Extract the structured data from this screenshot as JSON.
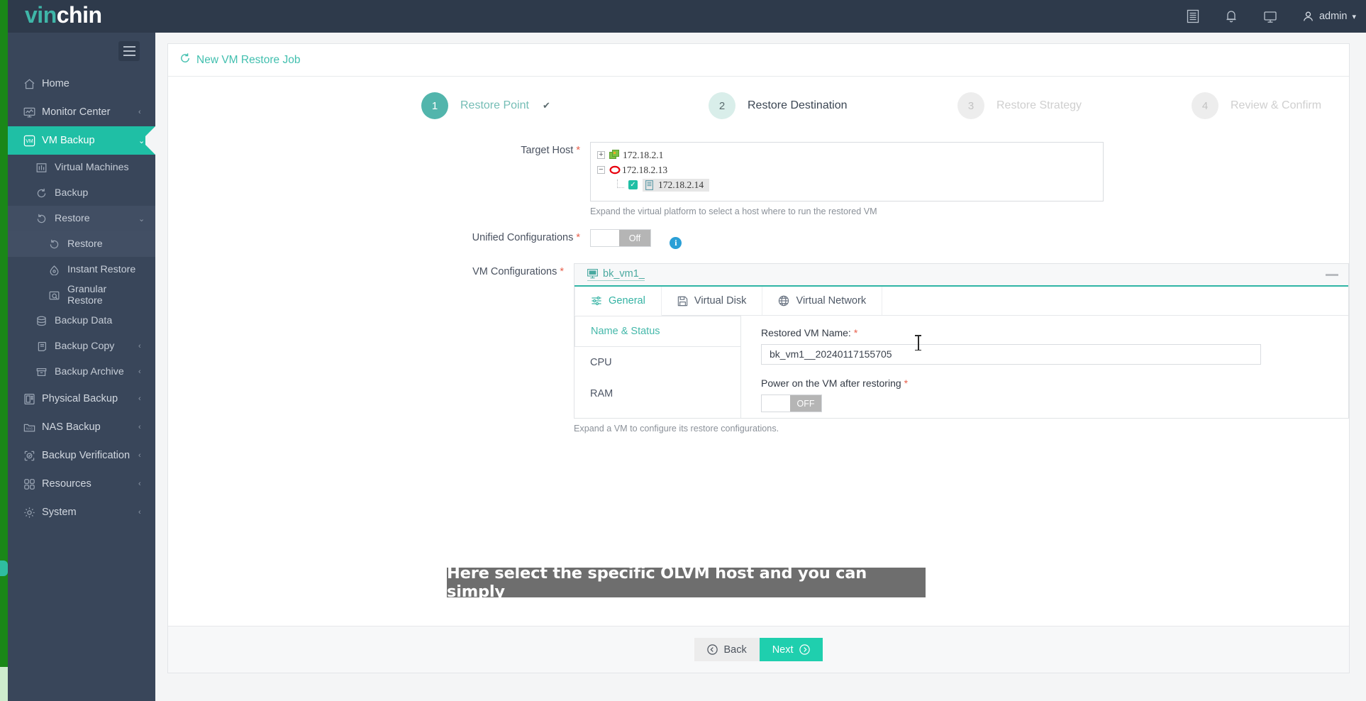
{
  "brand": {
    "part1": "vin",
    "part2": "chin"
  },
  "header": {
    "icons": [
      "list-icon",
      "bell-icon",
      "monitor-icon"
    ],
    "user": "admin"
  },
  "sidebar": {
    "items": [
      {
        "label": "Home",
        "icon": "home-icon",
        "level": 0,
        "caret": "",
        "state": "normal"
      },
      {
        "label": "Monitor Center",
        "icon": "monitor-chart-icon",
        "level": 0,
        "caret": "‹",
        "state": "normal"
      },
      {
        "label": "VM Backup",
        "icon": "vm-icon",
        "level": 0,
        "caret": "⌄",
        "state": "active"
      },
      {
        "label": "Virtual Machines",
        "icon": "grid-icon",
        "level": 1,
        "caret": "",
        "state": "normal"
      },
      {
        "label": "Backup",
        "icon": "refresh-icon",
        "level": 1,
        "caret": "",
        "state": "normal"
      },
      {
        "label": "Restore",
        "icon": "restore-icon",
        "level": 1,
        "caret": "⌄",
        "state": "open"
      },
      {
        "label": "Restore",
        "icon": "restore-icon",
        "level": 2,
        "caret": "",
        "state": "current"
      },
      {
        "label": "Instant Restore",
        "icon": "instant-icon",
        "level": 2,
        "caret": "",
        "state": "normal"
      },
      {
        "label": "Granular Restore",
        "icon": "granular-icon",
        "level": 2,
        "caret": "",
        "state": "normal"
      },
      {
        "label": "Backup Data",
        "icon": "database-icon",
        "level": 1,
        "caret": "",
        "state": "normal"
      },
      {
        "label": "Backup Copy",
        "icon": "copy-icon",
        "level": 1,
        "caret": "‹",
        "state": "normal"
      },
      {
        "label": "Backup Archive",
        "icon": "archive-icon",
        "level": 1,
        "caret": "‹",
        "state": "normal"
      },
      {
        "label": "Physical Backup",
        "icon": "server-icon",
        "level": 0,
        "caret": "‹",
        "state": "normal"
      },
      {
        "label": "NAS Backup",
        "icon": "nas-icon",
        "level": 0,
        "caret": "‹",
        "state": "normal"
      },
      {
        "label": "Backup Verification",
        "icon": "shield-check-icon",
        "level": 0,
        "caret": "‹",
        "state": "normal"
      },
      {
        "label": "Resources",
        "icon": "resources-icon",
        "level": 0,
        "caret": "‹",
        "state": "normal"
      },
      {
        "label": "System",
        "icon": "gear-icon",
        "level": 0,
        "caret": "‹",
        "state": "normal"
      }
    ]
  },
  "page": {
    "title": "New VM Restore Job",
    "title_icon": "restore-icon"
  },
  "stepper": {
    "steps": [
      {
        "num": "1",
        "label": "Restore Point",
        "state": "done",
        "check": "✔"
      },
      {
        "num": "2",
        "label": "Restore Destination",
        "state": "cur",
        "check": ""
      },
      {
        "num": "3",
        "label": "Restore Strategy",
        "state": "todo",
        "check": ""
      },
      {
        "num": "4",
        "label": "Review & Confirm",
        "state": "todo",
        "check": ""
      }
    ]
  },
  "form": {
    "target_host": {
      "label": "Target Host",
      "hint": "Expand the virtual platform to select a host where to run the restored VM",
      "nodes": [
        {
          "name": "172.18.2.1",
          "expander": "+",
          "icon": "platform-green-icon",
          "indent": 0,
          "checked": false,
          "selected": false
        },
        {
          "name": "172.18.2.13",
          "expander": "−",
          "icon": "platform-red-icon",
          "indent": 0,
          "checked": false,
          "selected": false
        },
        {
          "name": "172.18.2.14",
          "expander": "",
          "icon": "host-icon",
          "indent": 1,
          "checked": true,
          "selected": true
        }
      ]
    },
    "unified_configurations": {
      "label": "Unified Configurations",
      "toggle_state": "Off",
      "info_icon": "info-icon"
    },
    "vm_configurations": {
      "label": "VM Configurations",
      "vm_name": "bk_vm1_",
      "vm_icon": "vm-monitor-icon",
      "minimize_icon": "minimize-icon",
      "hint": "Expand a VM to configure its restore configurations.",
      "tabs": [
        {
          "label": "General",
          "icon": "sliders-icon",
          "active": true
        },
        {
          "label": "Virtual Disk",
          "icon": "floppy-icon",
          "active": false
        },
        {
          "label": "Virtual Network",
          "icon": "globe-icon",
          "active": false
        }
      ],
      "subnav": [
        {
          "label": "Name & Status",
          "active": true
        },
        {
          "label": "CPU",
          "active": false
        },
        {
          "label": "RAM",
          "active": false
        }
      ],
      "fields": {
        "restored_vm_name_label": "Restored VM Name:",
        "restored_vm_name_value": "bk_vm1__20240117155705",
        "power_on_label": "Power on the VM after restoring",
        "power_on_state": "OFF"
      }
    }
  },
  "footer": {
    "back_label": "Back",
    "next_label": "Next",
    "back_icon": "arrow-left-circle-icon",
    "next_icon": "arrow-right-circle-icon"
  },
  "caption": {
    "text": "Here select the specific OLVM host and you can simply"
  },
  "colors": {
    "brand_teal": "#1fbfa5",
    "sidebar": "#39465a",
    "topbar": "#2e3a4b",
    "accent_green": "#1a8718",
    "required_red": "#e8604c",
    "step_done": "#52b5ac",
    "step_current": "#d9eeea"
  }
}
